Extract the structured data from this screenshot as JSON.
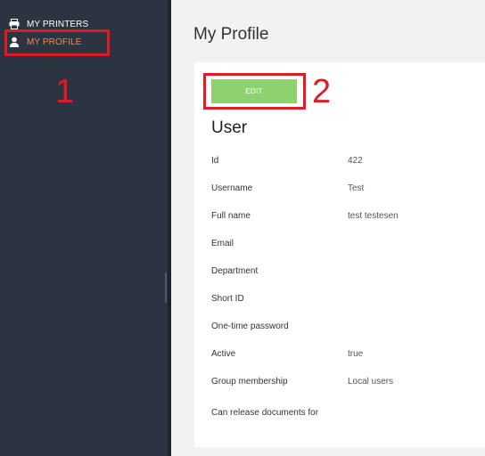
{
  "sidebar": {
    "items": [
      {
        "label": "MY PRINTERS",
        "icon": "printer-icon"
      },
      {
        "label": "MY PROFILE",
        "icon": "user-icon",
        "active": true
      }
    ]
  },
  "annotations": {
    "one": "1",
    "two": "2"
  },
  "main": {
    "title": "My Profile",
    "edit_label": "EDIT",
    "section_title": "User",
    "fields": [
      {
        "label": "Id",
        "value": "422"
      },
      {
        "label": "Username",
        "value": "Test"
      },
      {
        "label": "Full name",
        "value": "test testesen"
      },
      {
        "label": "Email",
        "value": ""
      },
      {
        "label": "Department",
        "value": ""
      },
      {
        "label": "Short ID",
        "value": ""
      },
      {
        "label": "One-time password",
        "value": ""
      },
      {
        "label": "Active",
        "value": "true"
      },
      {
        "label": "Group membership",
        "value": "Local users"
      },
      {
        "label": "Can release documents for",
        "value": ""
      }
    ]
  },
  "colors": {
    "sidebar_bg": "#2b3440",
    "active_nav": "#ec8a54",
    "edit_button": "#8ed26d",
    "annotation": "#e21b23"
  }
}
